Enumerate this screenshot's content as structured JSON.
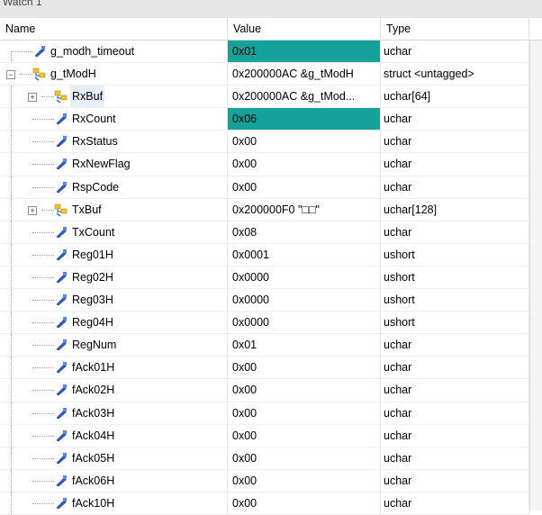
{
  "window": {
    "title": "Watch 1"
  },
  "columns": {
    "name": "Name",
    "value": "Value",
    "type": "Type"
  },
  "colors": {
    "highlight": "#14a19a"
  },
  "rows": [
    {
      "name": "g_modh_timeout",
      "value": "0x01",
      "type": "uchar",
      "depth": 0,
      "icon": "variable-icon",
      "expander": "",
      "highlight": true
    },
    {
      "name": "g_tModH",
      "value": "0x200000AC &g_tModH",
      "type": "struct <untagged>",
      "depth": 0,
      "icon": "struct-icon",
      "expander": "-",
      "highlight": false
    },
    {
      "name": "RxBuf",
      "value": "0x200000AC &g_tMod...",
      "type": "uchar[64]",
      "depth": 1,
      "icon": "struct-icon",
      "expander": "+",
      "highlight": false,
      "selected": true
    },
    {
      "name": "RxCount",
      "value": "0x06",
      "type": "uchar",
      "depth": 1,
      "icon": "variable-icon",
      "expander": "",
      "highlight": true
    },
    {
      "name": "RxStatus",
      "value": "0x00",
      "type": "uchar",
      "depth": 1,
      "icon": "variable-icon",
      "expander": "",
      "highlight": false
    },
    {
      "name": "RxNewFlag",
      "value": "0x00",
      "type": "uchar",
      "depth": 1,
      "icon": "variable-icon",
      "expander": "",
      "highlight": false
    },
    {
      "name": "RspCode",
      "value": "0x00",
      "type": "uchar",
      "depth": 1,
      "icon": "variable-icon",
      "expander": "",
      "highlight": false
    },
    {
      "name": "TxBuf",
      "value": "0x200000F0 \"□□\"",
      "type": "uchar[128]",
      "depth": 1,
      "icon": "struct-icon",
      "expander": "+",
      "highlight": false
    },
    {
      "name": "TxCount",
      "value": "0x08",
      "type": "uchar",
      "depth": 1,
      "icon": "variable-icon",
      "expander": "",
      "highlight": false
    },
    {
      "name": "Reg01H",
      "value": "0x0001",
      "type": "ushort",
      "depth": 1,
      "icon": "variable-icon",
      "expander": "",
      "highlight": false
    },
    {
      "name": "Reg02H",
      "value": "0x0000",
      "type": "ushort",
      "depth": 1,
      "icon": "variable-icon",
      "expander": "",
      "highlight": false
    },
    {
      "name": "Reg03H",
      "value": "0x0000",
      "type": "ushort",
      "depth": 1,
      "icon": "variable-icon",
      "expander": "",
      "highlight": false
    },
    {
      "name": "Reg04H",
      "value": "0x0000",
      "type": "ushort",
      "depth": 1,
      "icon": "variable-icon",
      "expander": "",
      "highlight": false
    },
    {
      "name": "RegNum",
      "value": "0x01",
      "type": "uchar",
      "depth": 1,
      "icon": "variable-icon",
      "expander": "",
      "highlight": false
    },
    {
      "name": "fAck01H",
      "value": "0x00",
      "type": "uchar",
      "depth": 1,
      "icon": "variable-icon",
      "expander": "",
      "highlight": false
    },
    {
      "name": "fAck02H",
      "value": "0x00",
      "type": "uchar",
      "depth": 1,
      "icon": "variable-icon",
      "expander": "",
      "highlight": false
    },
    {
      "name": "fAck03H",
      "value": "0x00",
      "type": "uchar",
      "depth": 1,
      "icon": "variable-icon",
      "expander": "",
      "highlight": false
    },
    {
      "name": "fAck04H",
      "value": "0x00",
      "type": "uchar",
      "depth": 1,
      "icon": "variable-icon",
      "expander": "",
      "highlight": false
    },
    {
      "name": "fAck05H",
      "value": "0x00",
      "type": "uchar",
      "depth": 1,
      "icon": "variable-icon",
      "expander": "",
      "highlight": false
    },
    {
      "name": "fAck06H",
      "value": "0x00",
      "type": "uchar",
      "depth": 1,
      "icon": "variable-icon",
      "expander": "",
      "highlight": false
    },
    {
      "name": "fAck10H",
      "value": "0x00",
      "type": "uchar",
      "depth": 1,
      "icon": "variable-icon",
      "expander": "",
      "highlight": false
    }
  ]
}
